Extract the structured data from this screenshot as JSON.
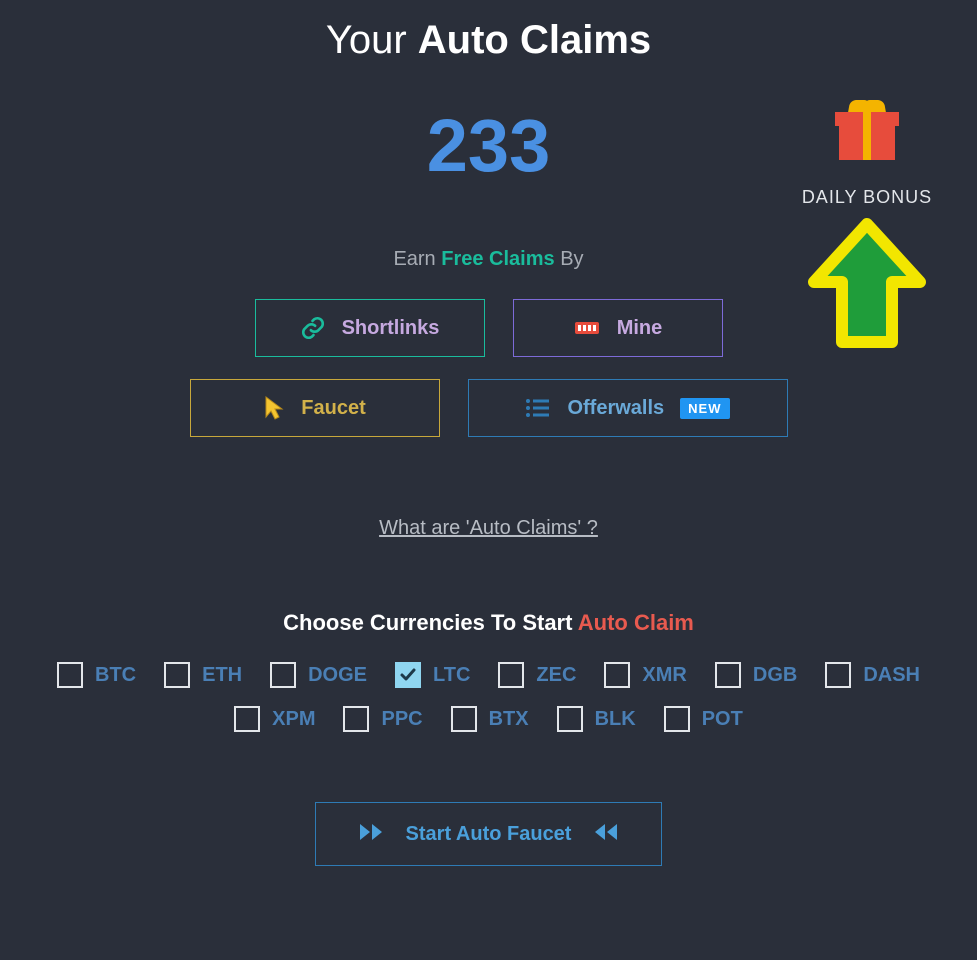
{
  "title_pre": "Your ",
  "title_bold": "Auto Claims",
  "count": "233",
  "bonus_label": "DAILY BONUS",
  "earn": {
    "pre": "Earn ",
    "mid": "Free Claims",
    "post": " By"
  },
  "buttons": {
    "shortlinks": "Shortlinks",
    "mine": "Mine",
    "faucet": "Faucet",
    "offerwalls": "Offerwalls",
    "new_badge": "NEW"
  },
  "what_link": "What are 'Auto Claims' ?",
  "choose_pre": "Choose Currencies To Start ",
  "choose_red": "Auto Claim",
  "currencies": [
    {
      "label": "BTC",
      "checked": false
    },
    {
      "label": "ETH",
      "checked": false
    },
    {
      "label": "DOGE",
      "checked": false
    },
    {
      "label": "LTC",
      "checked": true
    },
    {
      "label": "ZEC",
      "checked": false
    },
    {
      "label": "XMR",
      "checked": false
    },
    {
      "label": "DGB",
      "checked": false
    },
    {
      "label": "DASH",
      "checked": false
    },
    {
      "label": "XPM",
      "checked": false
    },
    {
      "label": "PPC",
      "checked": false
    },
    {
      "label": "BTX",
      "checked": false
    },
    {
      "label": "BLK",
      "checked": false
    },
    {
      "label": "POT",
      "checked": false
    }
  ],
  "start_label": "Start Auto Faucet",
  "colors": {
    "bg": "#2a2f3a",
    "accent_blue": "#4a90e2",
    "teal": "#1abc9c",
    "purple": "#7d6bd8",
    "yellow": "#c7a83b",
    "blue_border": "#2e7bb5",
    "red": "#e85a4f"
  }
}
